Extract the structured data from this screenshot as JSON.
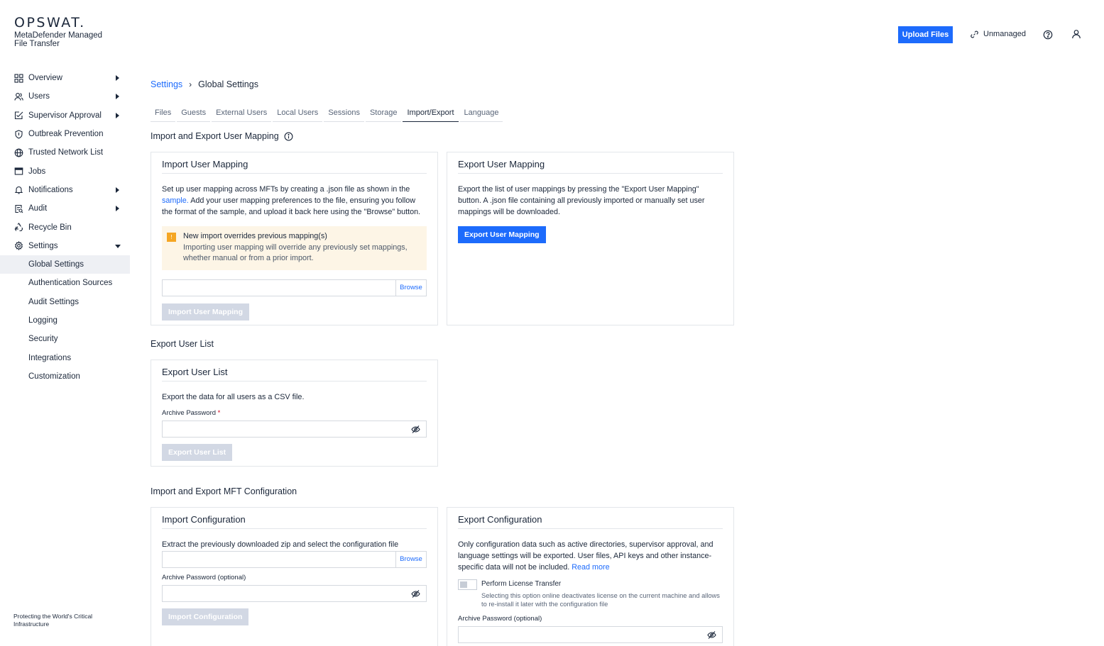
{
  "brand": {
    "logo": "OPSWAT.",
    "product": "MetaDefender Managed File Transfer",
    "footer": "Protecting the World's Critical Infrastructure"
  },
  "topbar": {
    "upload_label": "Upload Files",
    "unmanaged_label": "Unmanaged"
  },
  "nav": {
    "overview": "Overview",
    "users": "Users",
    "supervisor": "Supervisor Approval",
    "outbreak": "Outbreak Prevention",
    "trusted": "Trusted Network List",
    "jobs": "Jobs",
    "notifications": "Notifications",
    "audit": "Audit",
    "recycle": "Recycle Bin",
    "settings": "Settings",
    "sub": {
      "global": "Global Settings",
      "auth": "Authentication Sources",
      "audit_settings": "Audit Settings",
      "logging": "Logging",
      "security": "Security",
      "integrations": "Integrations",
      "customization": "Customization"
    }
  },
  "breadcrumb": {
    "parent": "Settings",
    "separator": "›",
    "current": "Global Settings"
  },
  "tabs": [
    "Files",
    "Guests",
    "External Users",
    "Local Users",
    "Sessions",
    "Storage",
    "Import/Export",
    "Language"
  ],
  "active_tab": "Import/Export",
  "sections": {
    "mapping": "Import and Export User Mapping",
    "userlist": "Export User List",
    "config": "Import and Export MFT Configuration"
  },
  "import_mapping": {
    "title": "Import User Mapping",
    "text_1": "Set up user mapping across MFTs by creating a .json file as shown in the",
    "link": "sample.",
    "text_2": "Add your user mapping preferences to the file, ensuring you follow the format of the sample, and upload it back here using the \"Browse\" button.",
    "warn_badge": "!",
    "warn_title": "New import overrides previous mapping(s)",
    "warn_desc": "Importing user mapping will override any previously set mappings, whether manual or from a prior import.",
    "browse": "Browse",
    "button": "Import User Mapping"
  },
  "export_mapping": {
    "title": "Export User Mapping",
    "text": "Export the list of user mappings by pressing the \"Export User Mapping\" button. A .json file containing all previously imported or manually set user mappings will be downloaded.",
    "button": "Export User Mapping"
  },
  "export_list": {
    "title": "Export User List",
    "text": "Export the data for all users as a CSV file.",
    "password_label": "Archive Password",
    "required_mark": "*",
    "button": "Export User List"
  },
  "import_config": {
    "title": "Import Configuration",
    "text": "Extract the previously downloaded zip and select the configuration file",
    "browse": "Browse",
    "password_label": "Archive Password (optional)",
    "button": "Import Configuration"
  },
  "export_config": {
    "title": "Export Configuration",
    "text": "Only configuration data such as active directories, supervisor approval, and language settings will be exported. User files, API keys and other instance-specific data will not be included.",
    "link": "Read more",
    "toggle_label": "Perform License Transfer",
    "toggle_desc": "Selecting this option online deactivates license on the current machine and allows to re-install it later with the configuration file",
    "password_label": "Archive Password (optional)"
  },
  "colors": {
    "accent": "#1d6bfc",
    "warning": "#f5a623",
    "disabled": "#d2d8e4"
  }
}
